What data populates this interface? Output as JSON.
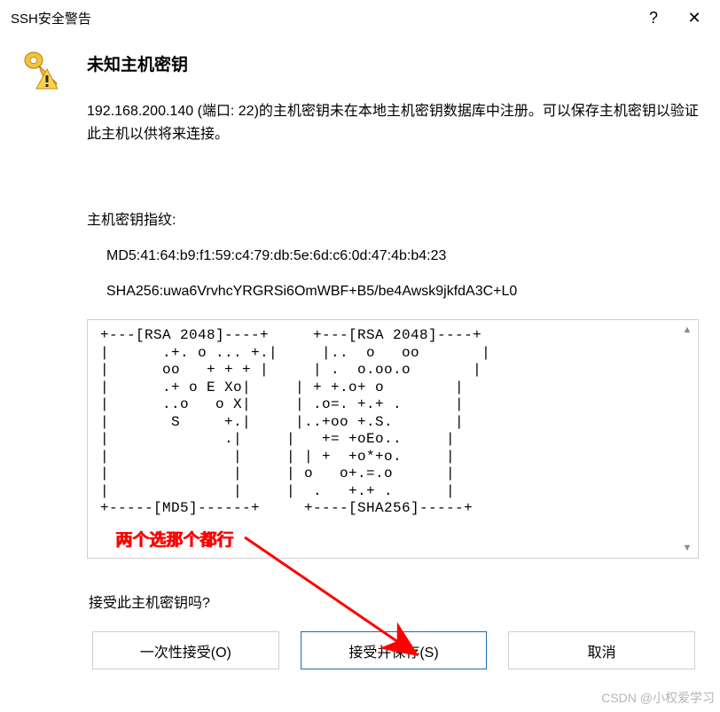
{
  "titlebar": {
    "title": "SSH安全警告",
    "help": "?",
    "close": "✕"
  },
  "dialog": {
    "heading": "未知主机密钥",
    "description": "192.168.200.140 (端口: 22)的主机密钥未在本地主机密钥数据库中注册。可以保存主机密钥以验证此主机以供将来连接。",
    "fingerprint_label": "主机密钥指纹:",
    "md5": "MD5:41:64:b9:f1:59:c4:79:db:5e:6d:c6:0d:47:4b:b4:23",
    "sha256": "SHA256:uwa6VrvhcYRGRSi6OmWBF+B5/be4Awsk9jkfdA3C+L0",
    "ascii_art": "+---[RSA 2048]----+     +---[RSA 2048]----+\n|      .+. o ... +.|     |..  o   oo       |\n|      oo   + + + |     | .  o.oo.o       |\n|      .+ o E Xo|     | + +.o+ o        |\n|      ..o   o X|     | .o=. +.+ .      |\n|       S     +.|     |..+oo +.S.       |\n|             .|     |   += +oEo..     |\n|              |     | | +  +o*+o.     |\n|              |     | o   o+.=.o      |\n|              |     |  .   +.+ .      |\n+-----[MD5]------+     +----[SHA256]-----+",
    "prompt": "接受此主机密钥吗?"
  },
  "annotation": {
    "text": "两个选那个都行"
  },
  "buttons": {
    "accept_once": "一次性接受(O)",
    "accept_save": "接受并保存(S)",
    "cancel": "取消"
  },
  "watermark": "CSDN @小权爱学习"
}
